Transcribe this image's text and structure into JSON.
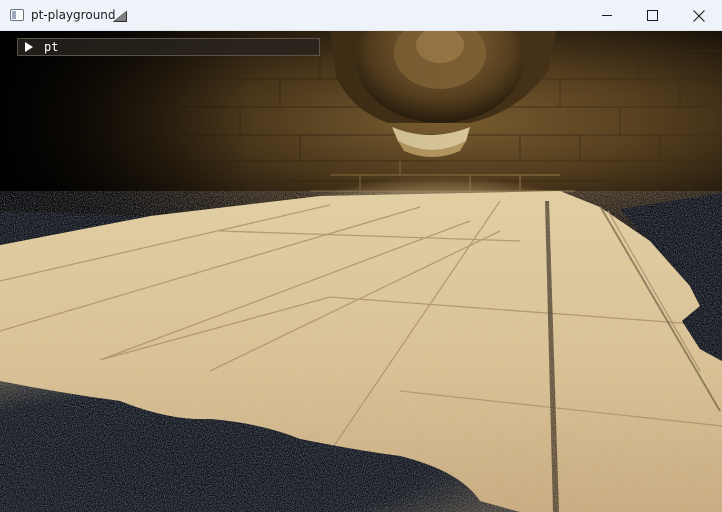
{
  "window": {
    "title": "pt-playground",
    "title_emoji": "railway-ramp-icon"
  },
  "titlebar": {
    "icons": {
      "app": "app-window-icon",
      "minimize": "minimize-icon",
      "maximize": "maximize-icon",
      "close": "close-icon"
    }
  },
  "gui": {
    "collapsed": true,
    "label": "pt",
    "arrow_icon": "triangle-right-icon"
  },
  "scene": {
    "description_colors": {
      "stone_light": "#e8cf97",
      "stone_mid": "#c8a56a",
      "wall_dark": "#3a2a14",
      "shadow": "#0b0d12"
    }
  }
}
